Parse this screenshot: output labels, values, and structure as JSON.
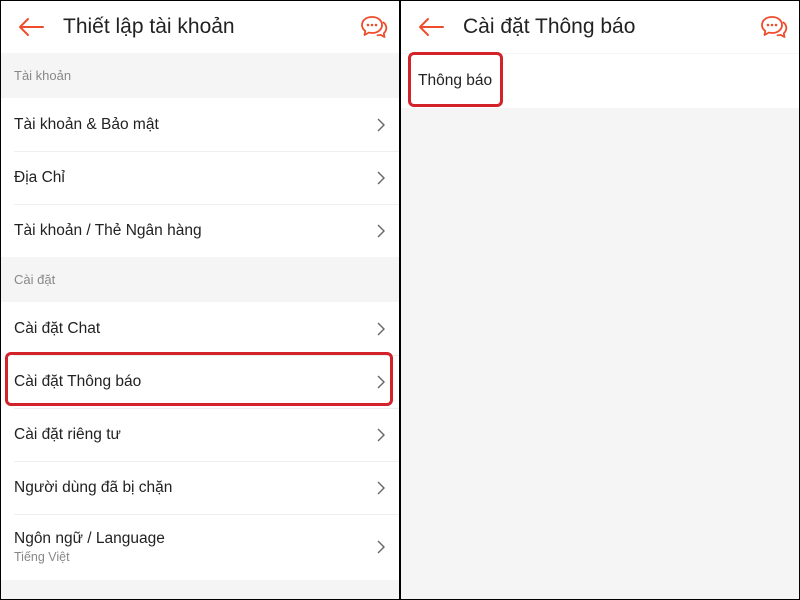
{
  "colors": {
    "accent": "#ee4d2d",
    "highlight": "#d3222a"
  },
  "left_screen": {
    "header": {
      "title": "Thiết lập tài khoản",
      "back_icon": "arrow-left-icon",
      "chat_icon": "chat-bubbles-icon"
    },
    "sections": [
      {
        "label": "Tài khoản",
        "items": [
          {
            "label": "Tài khoản & Bảo mật"
          },
          {
            "label": "Địa Chỉ"
          },
          {
            "label": "Tài khoản / Thẻ Ngân hàng"
          }
        ]
      },
      {
        "label": "Cài đặt",
        "items": [
          {
            "label": "Cài đặt Chat"
          },
          {
            "label": "Cài đặt Thông báo",
            "highlighted": true
          },
          {
            "label": "Cài đặt riêng tư"
          },
          {
            "label": "Người dùng đã bị chặn"
          },
          {
            "label": "Ngôn ngữ / Language",
            "sublabel": "Tiếng Việt"
          }
        ]
      }
    ]
  },
  "right_screen": {
    "header": {
      "title": "Cài đặt Thông báo",
      "back_icon": "arrow-left-icon",
      "chat_icon": "chat-bubbles-icon"
    },
    "items": [
      {
        "label": "Thông báo",
        "highlighted": true
      }
    ]
  }
}
